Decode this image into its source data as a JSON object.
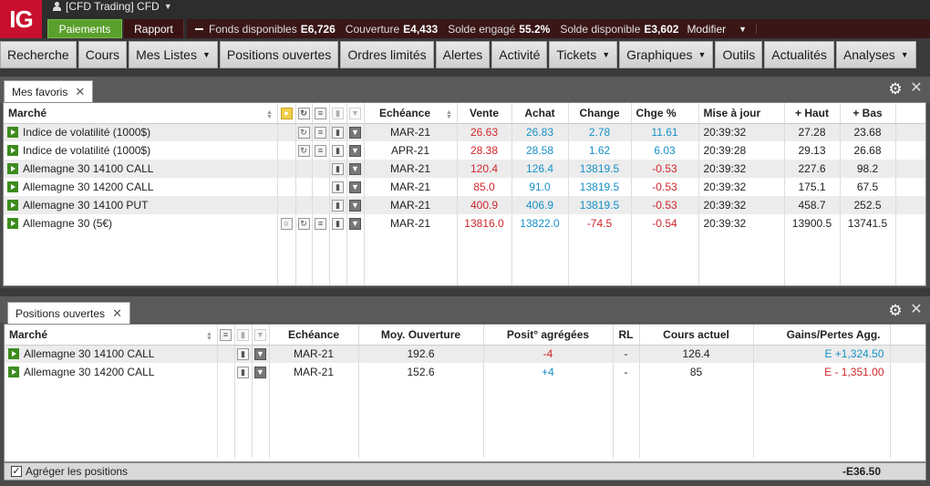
{
  "app": {
    "logo": "IG",
    "account": "[CFD Trading] CFD"
  },
  "subbar": {
    "payments": "Paiements",
    "report": "Rapport",
    "funds": [
      {
        "label": "Fonds disponibles",
        "value": "E6,726"
      },
      {
        "label": "Couverture",
        "value": "E4,433"
      },
      {
        "label": "Solde engagé",
        "value": "55.2%"
      },
      {
        "label": "Solde disponible",
        "value": "E3,602"
      }
    ],
    "modify": "Modifier"
  },
  "nav": [
    {
      "label": "Recherche",
      "dropdown": false
    },
    {
      "label": "Cours",
      "dropdown": false
    },
    {
      "label": "Mes Listes",
      "dropdown": true
    },
    {
      "label": "Positions ouvertes",
      "dropdown": false
    },
    {
      "label": "Ordres limités",
      "dropdown": false
    },
    {
      "label": "Alertes",
      "dropdown": false
    },
    {
      "label": "Activité",
      "dropdown": false
    },
    {
      "label": "Tickets",
      "dropdown": true
    },
    {
      "label": "Graphiques",
      "dropdown": true
    },
    {
      "label": "Outils",
      "dropdown": false
    },
    {
      "label": "Actualités",
      "dropdown": false
    },
    {
      "label": "Analyses",
      "dropdown": true
    }
  ],
  "favorites": {
    "tab": "Mes favoris",
    "headers": {
      "market": "Marché",
      "expiry": "Echéance",
      "sell": "Vente",
      "buy": "Achat",
      "change": "Change",
      "change_pct": "Chge %",
      "update": "Mise à jour",
      "high": "+ Haut",
      "low": "+ Bas"
    },
    "rows": [
      {
        "market": "Indice de volatilité (1000$)",
        "expiry": "MAR-21",
        "sell": "26.63",
        "sell_color": "red",
        "buy": "26.83",
        "change": "2.78",
        "change_color": "blue",
        "change_pct": "11.61",
        "pct_color": "blue",
        "update": "20:39:32",
        "high": "27.28",
        "low": "23.68",
        "icons": "volatility"
      },
      {
        "market": "Indice de volatilité (1000$)",
        "expiry": "APR-21",
        "sell": "28.38",
        "sell_color": "red",
        "buy": "28.58",
        "change": "1.62",
        "change_color": "blue",
        "change_pct": "6.03",
        "pct_color": "blue",
        "update": "20:39:28",
        "high": "29.13",
        "low": "26.68",
        "icons": "volatility"
      },
      {
        "market": "Allemagne 30 14100 CALL",
        "expiry": "MAR-21",
        "sell": "120.4",
        "sell_color": "red",
        "buy": "126.4",
        "change": "13819.5",
        "change_color": "blue",
        "change_pct": "-0.53",
        "pct_color": "red",
        "update": "20:39:32",
        "high": "227.6",
        "low": "98.2",
        "icons": "option"
      },
      {
        "market": "Allemagne 30 14200 CALL",
        "expiry": "MAR-21",
        "sell": "85.0",
        "sell_color": "red",
        "buy": "91.0",
        "change": "13819.5",
        "change_color": "blue",
        "change_pct": "-0.53",
        "pct_color": "red",
        "update": "20:39:32",
        "high": "175.1",
        "low": "67.5",
        "icons": "option"
      },
      {
        "market": "Allemagne 30 14100 PUT",
        "expiry": "MAR-21",
        "sell": "400.9",
        "sell_color": "red",
        "buy": "406.9",
        "change": "13819.5",
        "change_color": "blue",
        "change_pct": "-0.53",
        "pct_color": "red",
        "update": "20:39:32",
        "high": "458.7",
        "low": "252.5",
        "icons": "option"
      },
      {
        "market": "Allemagne 30 (5€)",
        "expiry": "MAR-21",
        "sell": "13816.0",
        "sell_color": "red",
        "buy": "13822.0",
        "change": "-74.5",
        "change_color": "red",
        "change_pct": "-0.54",
        "pct_color": "red",
        "update": "20:39:32",
        "high": "13900.5",
        "low": "13741.5",
        "icons": "full"
      }
    ]
  },
  "positions": {
    "tab": "Positions ouvertes",
    "headers": {
      "market": "Marché",
      "expiry": "Echéance",
      "avg_open": "Moy. Ouverture",
      "aggregated": "Posit° agrégées",
      "rl": "RL",
      "current": "Cours actuel",
      "pnl": "Gains/Pertes Agg."
    },
    "rows": [
      {
        "market": "Allemagne 30 14100 CALL",
        "expiry": "MAR-21",
        "avg_open": "192.6",
        "aggregated": "-4",
        "agg_color": "red",
        "rl": "-",
        "current": "126.4",
        "pnl": "E +1,324.50",
        "pnl_color": "blue"
      },
      {
        "market": "Allemagne 30 14200 CALL",
        "expiry": "MAR-21",
        "avg_open": "152.6",
        "aggregated": "+4",
        "agg_color": "blue",
        "rl": "-",
        "current": "85",
        "pnl": "E - 1,351.00",
        "pnl_color": "red"
      }
    ],
    "aggregate_label": "Agréger les positions",
    "aggregate_checked": true,
    "total": "-E36.50"
  },
  "colors": {
    "brand": "#c8102e",
    "payments_green": "#5aa02c",
    "negative": "#d0262b",
    "positive": "#1690c8"
  }
}
